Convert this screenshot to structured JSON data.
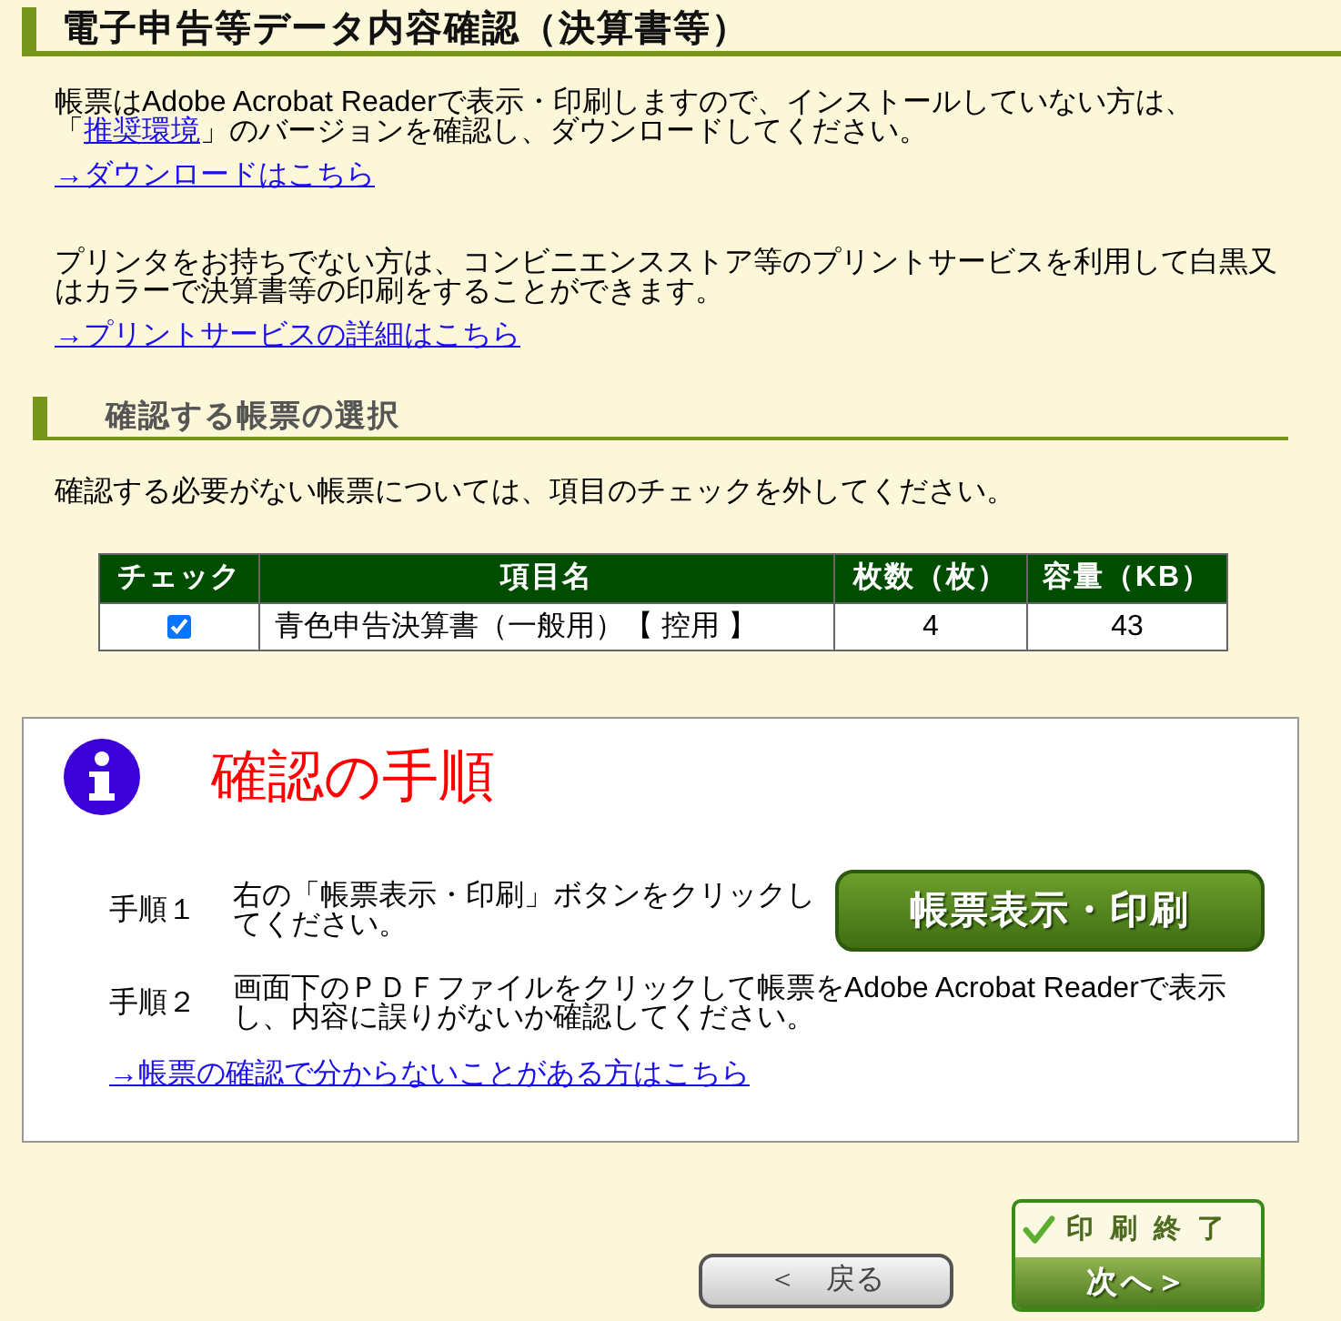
{
  "page_title": "電子申告等データ内容確認（決算書等）",
  "notices": [
    {
      "parts": [
        {
          "kind": "text",
          "text": "帳票はAdobe Acrobat Readerで表示・印刷しますので、インストールしていない方は、「"
        },
        {
          "kind": "link",
          "text": "推奨環境"
        },
        {
          "kind": "text",
          "text": "」のバージョンを確認し、ダウンロードしてください。"
        }
      ],
      "link": "→ダウンロードはこちら"
    },
    {
      "parts": [
        {
          "kind": "text",
          "text": "プリンタをお持ちでない方は、コンビニエンスストア等のプリントサービスを利用して白黒又はカラーで決算書等の印刷をすることができます。"
        }
      ],
      "link": "→プリントサービスの詳細はこちら"
    }
  ],
  "selection": {
    "title": "確認する帳票の選択",
    "instruction": "確認する必要がない帳票については、項目のチェックを外してください。",
    "table": {
      "columns": [
        "チェック",
        "項目名",
        "枚数（枚）",
        "容量（KB）"
      ],
      "rows": [
        {
          "checked": true,
          "cells": [
            "",
            "青色申告決算書（一般用）【 控用 】",
            "4",
            "43"
          ]
        }
      ]
    }
  },
  "procedure": {
    "title": "確認の手順",
    "steps": [
      {
        "label": "手順１",
        "text": "右の「帳票表示・印刷」ボタンをクリックしてください。"
      },
      {
        "label": "手順２",
        "text": "画面下のＰＤＦファイルをクリックして帳票をAdobe Acrobat Readerで表示し、内容に誤りがないか確認してください。"
      }
    ],
    "print_button": "帳票表示・印刷",
    "help_link": "→帳票の確認で分からないことがある方はこちら"
  },
  "footer": {
    "back_button": "＜　戻る",
    "finish_button": {
      "status": "印刷終了",
      "label": "次へ＞"
    }
  }
}
